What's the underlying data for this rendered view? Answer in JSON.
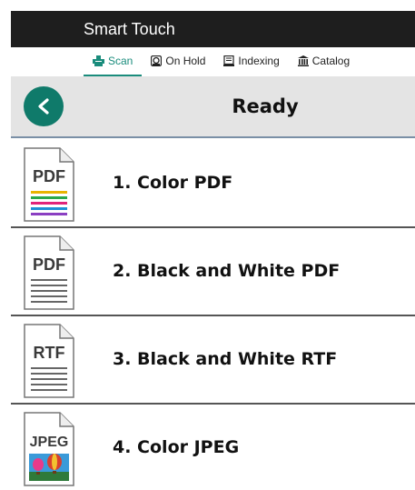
{
  "app": {
    "title": "Smart Touch"
  },
  "tabs": [
    {
      "label": "Scan",
      "icon": "scanner-icon",
      "active": true
    },
    {
      "label": "On Hold",
      "icon": "hold-icon",
      "active": false
    },
    {
      "label": "Indexing",
      "icon": "indexing-icon",
      "active": false
    },
    {
      "label": "Catalog",
      "icon": "catalog-icon",
      "active": false
    }
  ],
  "header": {
    "back_label": "<",
    "title": "Ready"
  },
  "scan_options": [
    {
      "label": "1. Color PDF",
      "file_type": "PDF",
      "icon": "color-pdf-file-icon"
    },
    {
      "label": "2. Black and White PDF",
      "file_type": "PDF",
      "icon": "bw-pdf-file-icon"
    },
    {
      "label": "3. Black and White RTF",
      "file_type": "RTF",
      "icon": "bw-rtf-file-icon"
    },
    {
      "label": "4. Color JPEG",
      "file_type": "JPEG",
      "icon": "color-jpeg-file-icon"
    }
  ],
  "colors": {
    "accent": "#0f7a6a",
    "tab_active": "#1a8c7c",
    "title_bar": "#1e1e1e",
    "header_bg": "#e4e4e4"
  }
}
